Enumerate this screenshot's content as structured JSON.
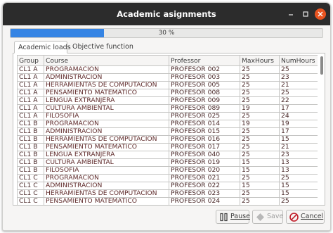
{
  "window": {
    "title": "Academic asignments"
  },
  "progress": {
    "value": 0.3,
    "label": "30 %"
  },
  "tabs": [
    {
      "label": "Academic loads",
      "active": true
    },
    {
      "label": "Objective function",
      "active": false
    }
  ],
  "table": {
    "columns": [
      "Group",
      "Course",
      "Professor",
      "MaxHours",
      "NumHours"
    ],
    "rows": [
      [
        "CL1 A",
        "PROGRAMACION",
        "PROFESOR 002",
        "25",
        "25"
      ],
      [
        "CL1 A",
        "ADMINISTRACION",
        "PROFESOR 003",
        "25",
        "23"
      ],
      [
        "CL1 A",
        "HERRAMIENTAS DE COMPUTACION",
        "PROFESOR 005",
        "25",
        "21"
      ],
      [
        "CL1 A",
        "PENSAMIENTO MATEMATICO",
        "PROFESOR 008",
        "25",
        "25"
      ],
      [
        "CL1 A",
        "LENGUA EXTRANJERA",
        "PROFESOR 009",
        "25",
        "22"
      ],
      [
        "CL1 A",
        "CULTURA AMBIENTAL",
        "PROFESOR 089",
        "19",
        "17"
      ],
      [
        "CL1 A",
        "FILOSOFIA",
        "PROFESOR 025",
        "25",
        "24"
      ],
      [
        "CL1 B",
        "PROGRAMACION",
        "PROFESOR 014",
        "19",
        "19"
      ],
      [
        "CL1 B",
        "ADMINISTRACION",
        "PROFESOR 015",
        "25",
        "17"
      ],
      [
        "CL1 B",
        "HERRAMIENTAS DE COMPUTACION",
        "PROFESOR 016",
        "25",
        "15"
      ],
      [
        "CL1 B",
        "PENSAMIENTO MATEMATICO",
        "PROFESOR 017",
        "25",
        "21"
      ],
      [
        "CL1 B",
        "LENGUA EXTRANJERA",
        "PROFESOR 040",
        "25",
        "23"
      ],
      [
        "CL1 B",
        "CULTURA AMBIENTAL",
        "PROFESOR 019",
        "15",
        "13"
      ],
      [
        "CL1 B",
        "FILOSOFIA",
        "PROFESOR 020",
        "15",
        "13"
      ],
      [
        "CL1 C",
        "PROGRAMACION",
        "PROFESOR 021",
        "25",
        "25"
      ],
      [
        "CL1 C",
        "ADMINISTRACION",
        "PROFESOR 022",
        "15",
        "15"
      ],
      [
        "CL1 C",
        "HERRAMIENTAS DE COMPUTACION",
        "PROFESOR 023",
        "25",
        "15"
      ],
      [
        "CL1 C",
        "PENSAMIENTO MATEMATICO",
        "PROFESOR 024",
        "25",
        "25"
      ]
    ]
  },
  "buttons": {
    "pause": {
      "label": "Pause",
      "icon": "pause-icon"
    },
    "save": {
      "label": "Save",
      "icon": "save-icon",
      "enabled": false
    },
    "cancel": {
      "label": "Cancel",
      "icon": "cancel-icon"
    }
  },
  "colors": {
    "titlebar": "#2c2c2c",
    "progress_fill": "#3584e4",
    "close_button": "#e95420",
    "cancel_icon": "#c01c28"
  }
}
